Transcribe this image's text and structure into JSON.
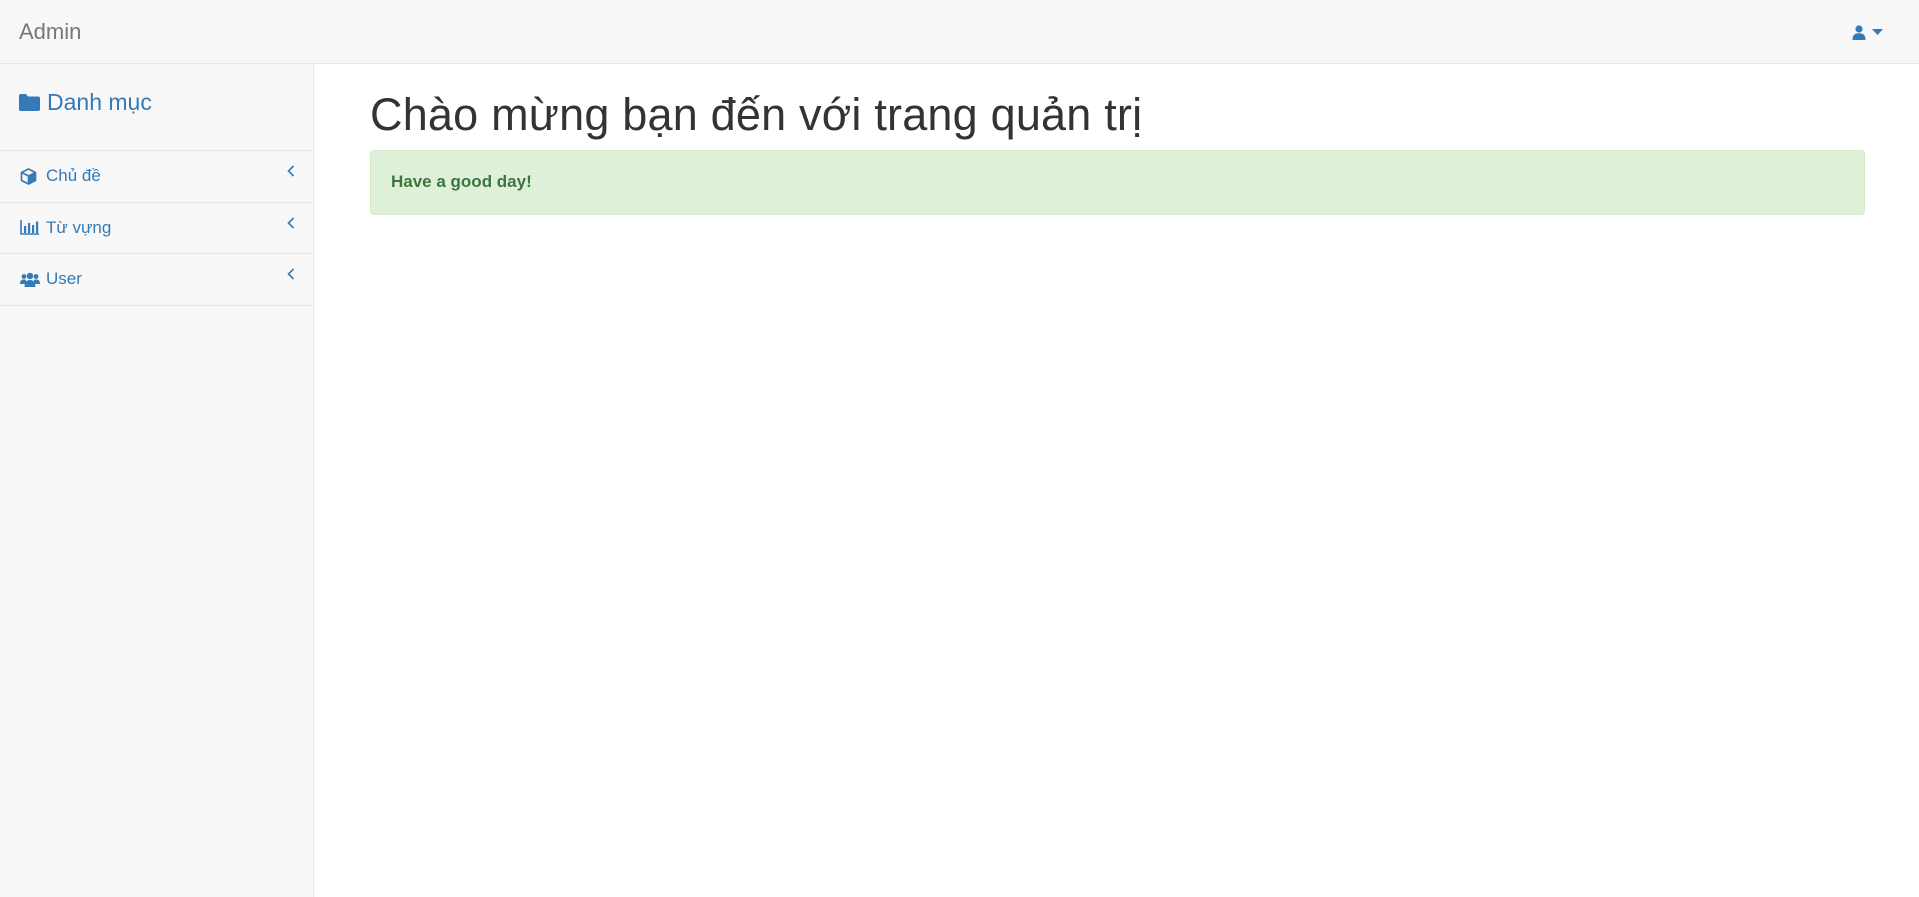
{
  "navbar": {
    "brand": "Admin",
    "user_icon": "user-icon",
    "caret_icon": "caret-down-icon"
  },
  "sidebar": {
    "header": {
      "label": "Danh mục",
      "icon": "folder-icon"
    },
    "items": [
      {
        "label": "Chủ đề",
        "icon": "cube-icon",
        "chevron": "chevron-left-icon"
      },
      {
        "label": "Từ vựng",
        "icon": "bar-chart-icon",
        "chevron": "chevron-left-icon"
      },
      {
        "label": "User",
        "icon": "users-icon",
        "chevron": "chevron-left-icon"
      }
    ]
  },
  "main": {
    "title": "Chào mừng bạn đến với trang quản trị",
    "alert": "Have a good day!"
  },
  "colors": {
    "link": "#337ab7",
    "navbar_bg": "#f8f8f8",
    "alert_bg": "#dff0d8",
    "alert_text": "#3c763d"
  }
}
